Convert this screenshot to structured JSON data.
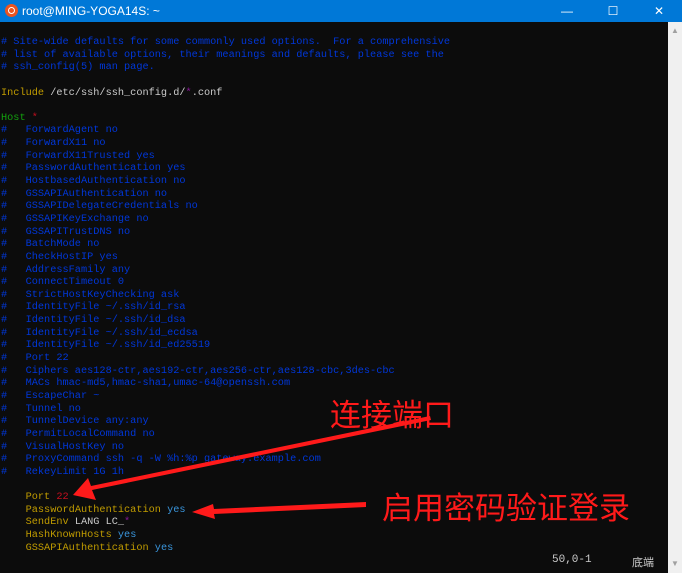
{
  "window": {
    "title": "root@MING-YOGA14S: ~",
    "controls": {
      "minimize": "—",
      "maximize": "☐",
      "close": "✕"
    }
  },
  "colors": {
    "comment": "#0037da",
    "orange": "#c19c00",
    "white": "#cccccc",
    "green": "#13a10e",
    "red": "#c50f1f",
    "purple": "#881798",
    "cyan": "#3a96dd",
    "annotation": "#ff1a1a",
    "titlebar": "#0078d7"
  },
  "terminal": {
    "lines": [
      [
        [
          "# Site-wide defaults for some commonly used options.  For a comprehensive",
          "comment"
        ]
      ],
      [
        [
          "# list of available options, their meanings and defaults, please see the",
          "comment"
        ]
      ],
      [
        [
          "# ssh_config(5) man page.",
          "comment"
        ]
      ],
      [],
      [
        [
          "Include",
          "orange"
        ],
        [
          " /etc/ssh/ssh_config.d/",
          "white"
        ],
        [
          "*",
          "purple"
        ],
        [
          ".conf",
          "white"
        ]
      ],
      [],
      [
        [
          "Host",
          "green"
        ],
        [
          " ",
          "white"
        ],
        [
          "*",
          "red"
        ]
      ],
      [
        [
          "#   ForwardAgent no",
          "comment"
        ]
      ],
      [
        [
          "#   ForwardX11 no",
          "comment"
        ]
      ],
      [
        [
          "#   ForwardX11Trusted yes",
          "comment"
        ]
      ],
      [
        [
          "#   PasswordAuthentication yes",
          "comment"
        ]
      ],
      [
        [
          "#   HostbasedAuthentication no",
          "comment"
        ]
      ],
      [
        [
          "#   GSSAPIAuthentication no",
          "comment"
        ]
      ],
      [
        [
          "#   GSSAPIDelegateCredentials no",
          "comment"
        ]
      ],
      [
        [
          "#   GSSAPIKeyExchange no",
          "comment"
        ]
      ],
      [
        [
          "#   GSSAPITrustDNS no",
          "comment"
        ]
      ],
      [
        [
          "#   BatchMode no",
          "comment"
        ]
      ],
      [
        [
          "#   CheckHostIP yes",
          "comment"
        ]
      ],
      [
        [
          "#   AddressFamily any",
          "comment"
        ]
      ],
      [
        [
          "#   ConnectTimeout 0",
          "comment"
        ]
      ],
      [
        [
          "#   StrictHostKeyChecking ask",
          "comment"
        ]
      ],
      [
        [
          "#   IdentityFile ~/.ssh/id_rsa",
          "comment"
        ]
      ],
      [
        [
          "#   IdentityFile ~/.ssh/id_dsa",
          "comment"
        ]
      ],
      [
        [
          "#   IdentityFile ~/.ssh/id_ecdsa",
          "comment"
        ]
      ],
      [
        [
          "#   IdentityFile ~/.ssh/id_ed25519",
          "comment"
        ]
      ],
      [
        [
          "#   Port 22",
          "comment"
        ]
      ],
      [
        [
          "#   Ciphers aes128-ctr,aes192-ctr,aes256-ctr,aes128-cbc,3des-cbc",
          "comment"
        ]
      ],
      [
        [
          "#   MACs hmac-md5,hmac-sha1,umac-64@openssh.com",
          "comment"
        ]
      ],
      [
        [
          "#   EscapeChar ~",
          "comment"
        ]
      ],
      [
        [
          "#   Tunnel no",
          "comment"
        ]
      ],
      [
        [
          "#   TunnelDevice any:any",
          "comment"
        ]
      ],
      [
        [
          "#   PermitLocalCommand no",
          "comment"
        ]
      ],
      [
        [
          "#   VisualHostKey no",
          "comment"
        ]
      ],
      [
        [
          "#   ProxyCommand ssh -q -W %h:%p gateway.example.com",
          "comment"
        ]
      ],
      [
        [
          "#   RekeyLimit 1G 1h",
          "comment"
        ]
      ],
      [],
      [
        [
          "    ",
          "white"
        ],
        [
          "Port",
          "orange"
        ],
        [
          " ",
          "white"
        ],
        [
          "22",
          "red"
        ]
      ],
      [
        [
          "    ",
          "white"
        ],
        [
          "PasswordAuthentication",
          "orange"
        ],
        [
          " ",
          "white"
        ],
        [
          "yes",
          "cyan"
        ]
      ],
      [
        [
          "    ",
          "white"
        ],
        [
          "SendEnv",
          "orange"
        ],
        [
          " LANG LC_",
          "white"
        ],
        [
          "*",
          "purple"
        ]
      ],
      [
        [
          "    ",
          "white"
        ],
        [
          "HashKnownHosts",
          "orange"
        ],
        [
          " ",
          "white"
        ],
        [
          "yes",
          "cyan"
        ]
      ],
      [
        [
          "    ",
          "white"
        ],
        [
          "GSSAPIAuthentication",
          "orange"
        ],
        [
          " ",
          "white"
        ],
        [
          "yes",
          "cyan"
        ]
      ]
    ],
    "status": {
      "position": "50,0-1",
      "scroll": "底端"
    }
  },
  "annotations": {
    "port_label": "连接端口",
    "password_label": "启用密码验证登录"
  }
}
